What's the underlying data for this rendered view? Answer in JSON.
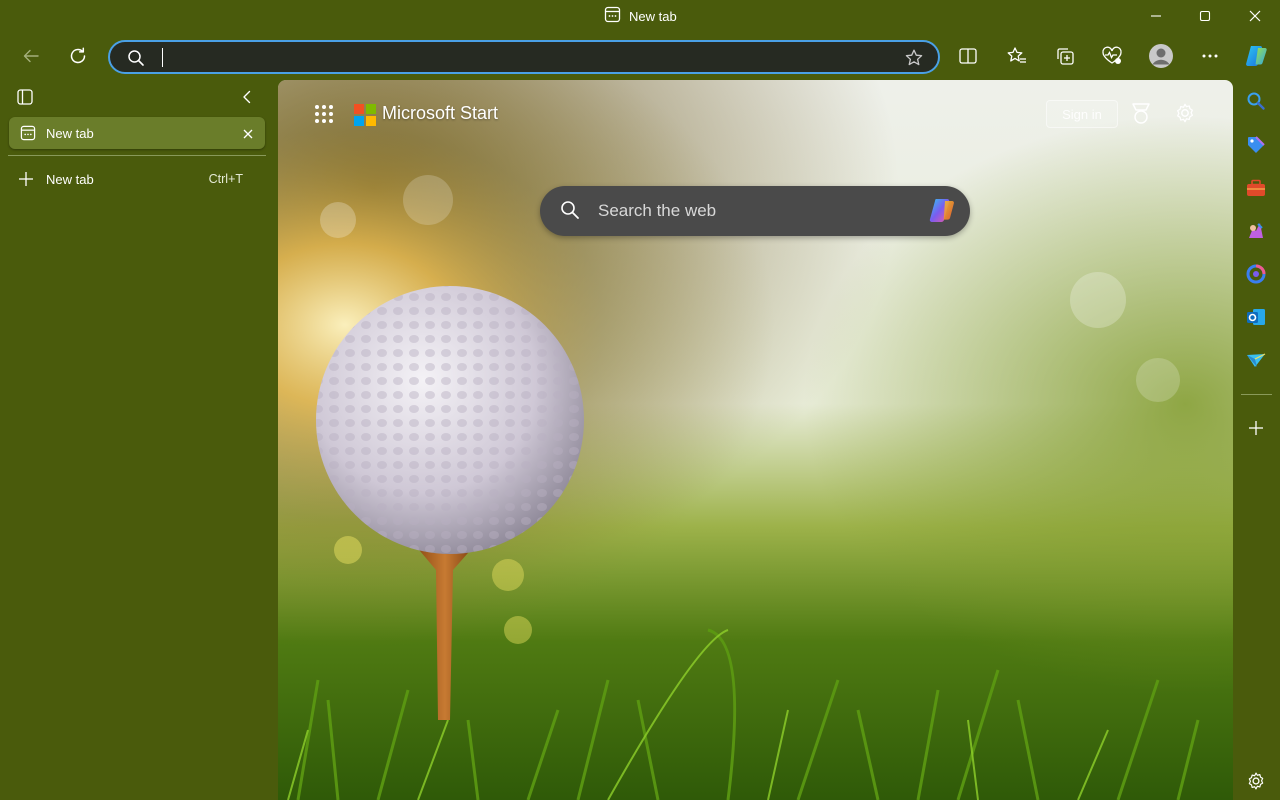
{
  "window": {
    "title": "New tab",
    "icons": {
      "minimize": "minimize-icon",
      "maximize": "maximize-icon",
      "close": "close-icon"
    }
  },
  "toolbar": {
    "address_value": "",
    "icons": [
      "back-icon",
      "refresh-icon",
      "search-icon",
      "favorite-star-icon",
      "split-screen-icon",
      "favorites-icon",
      "collections-icon",
      "browser-essentials-icon",
      "profile-icon",
      "more-icon",
      "copilot-icon"
    ]
  },
  "tabs_pane": {
    "active_tab": {
      "title": "New tab"
    },
    "new_tab": {
      "label": "New tab",
      "shortcut": "Ctrl+T"
    }
  },
  "ntp": {
    "brand": "Microsoft Start",
    "sign_in": "Sign in",
    "search_placeholder": "Search the web",
    "colors": {
      "logo_red": "#f25022",
      "logo_green": "#7fba00",
      "logo_blue": "#00a4ef",
      "logo_yellow": "#ffb900"
    }
  },
  "right_sidebar": {
    "icons": [
      "search-icon",
      "shopping-tag-icon",
      "tools-icon",
      "games-icon",
      "copilot-app-icon",
      "outlook-icon",
      "send-icon",
      "add-icon",
      "settings-icon"
    ]
  },
  "theme": {
    "accent": "#4a5b0c",
    "address_border": "#4aa0e6"
  }
}
